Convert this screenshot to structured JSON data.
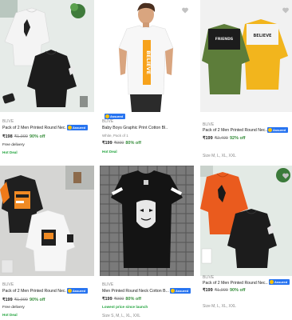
{
  "products": [
    {
      "brand": "BLIVE",
      "title": "Pack of 2 Men Printed Round Nec...",
      "assured": "Assured",
      "price": "₹198",
      "mrp": "₹1,999",
      "discount": "90% off",
      "delivery": "Free delivery",
      "badge": "Hot Deal"
    },
    {
      "brand": "BLIVE",
      "title": "Baby Boys Graphic Print Cotton Bl...",
      "assured": "Assured",
      "pack": "White, Pack of 1",
      "price": "₹199",
      "mrp": "₹999",
      "discount": "80% off",
      "badge": "Hot Deal",
      "tee_text": "BELIEVE"
    },
    {
      "brand": "BLIVE",
      "title": "Pack of 2 Men Printed Round Nec...",
      "assured": "Assured",
      "price": "₹199",
      "mrp": "₹2,499",
      "discount": "92% off",
      "sizes": "Size M, L, XL, XXL",
      "shirt_text_left": "FRIENDS",
      "shirt_text_right": "BELIEVE"
    },
    {
      "brand": "BLIVE",
      "title": "Pack of 2 Men Printed Round Nec...",
      "assured": "Assured",
      "price": "₹199",
      "mrp": "₹1,999",
      "discount": "90% off",
      "delivery": "Free delivery",
      "badge": "Hot Deal"
    },
    {
      "brand": "BLIVE",
      "title": "Men Printed Round Neck Cotton B...",
      "assured": "Assured",
      "price": "₹199",
      "mrp": "₹999",
      "discount": "80% off",
      "note": "Lowest price since launch",
      "sizes": "Size S, M, L, XL, XXL"
    },
    {
      "brand": "BLIVE",
      "title": "Pack of 2 Men Printed Round Nec...",
      "assured": "Assured",
      "price": "₹199",
      "mrp": "₹1,999",
      "discount": "90% off",
      "sizes": "Size M, L, XL, XXL"
    }
  ],
  "colors": {
    "accent_green": "#388e3c",
    "hot_deal_green": "#26a541",
    "assured_blue": "#2874f0",
    "wishlist_heart": "#c2c2c2"
  }
}
